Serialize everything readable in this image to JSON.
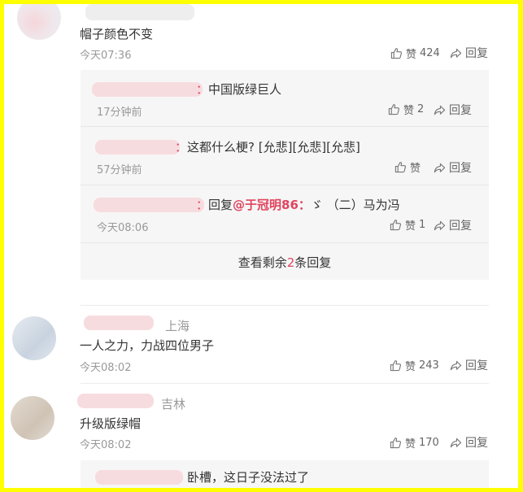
{
  "comments": [
    {
      "text": "帽子颜色不变",
      "time": "今天07:36",
      "like_label": "赞",
      "like_count": "424",
      "reply_label": "回复",
      "replies": [
        {
          "colon": "：",
          "text": "中国版绿巨人",
          "time": "17分钟前",
          "like_label": "赞",
          "like_count": "2",
          "reply_label": "回复"
        },
        {
          "colon": "：",
          "text": "这都什么梗? [允悲][允悲][允悲]",
          "time": "57分钟前",
          "like_label": "赞",
          "like_count": "",
          "reply_label": "回复"
        },
        {
          "colon": "：",
          "prefix": "回复",
          "mention": "@于冠明86：",
          "text": "ゞ （二）马为冯",
          "time": "今天08:06",
          "like_label": "赞",
          "like_count": "1",
          "reply_label": "回复"
        }
      ],
      "more_prefix": "查看剩余",
      "more_count": "2",
      "more_suffix": "条回复"
    },
    {
      "location": "上海",
      "text": "一人之力，力战四位男子",
      "time": "今天08:02",
      "like_label": "赞",
      "like_count": "243",
      "reply_label": "回复"
    },
    {
      "location": "吉林",
      "text": "升级版绿帽",
      "time": "今天08:02",
      "like_label": "赞",
      "like_count": "170",
      "reply_label": "回复",
      "replies": [
        {
          "text": "卧槽，这日子没法过了"
        }
      ]
    }
  ],
  "icons": {
    "like": "thumbs-up-icon",
    "reply": "share-arrow-icon"
  },
  "colors": {
    "border": "#ffff00",
    "mention": "#e0445e",
    "reply_bg": "#f6f6f6"
  }
}
